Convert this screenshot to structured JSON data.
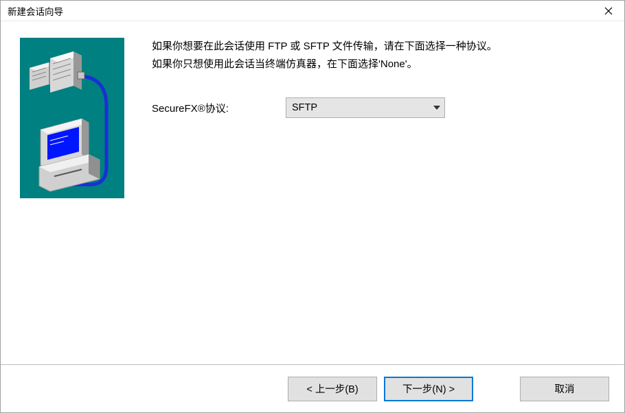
{
  "window": {
    "title": "新建会话向导"
  },
  "content": {
    "line1": "如果你想要在此会话使用 FTP 或 SFTP 文件传输，请在下面选择一种协议。",
    "line2": "如果你只想使用此会话当终端仿真器，在下面选择'None'。",
    "protocolLabel": "SecureFX®协议:",
    "protocolValue": "SFTP"
  },
  "buttons": {
    "back": "< 上一步(B)",
    "next": "下一步(N) >",
    "cancel": "取消"
  }
}
